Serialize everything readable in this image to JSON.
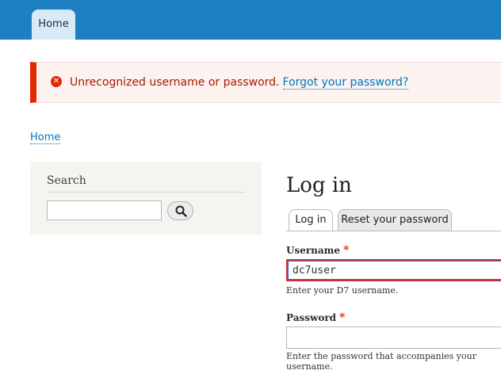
{
  "topbar": {
    "home_tab": "Home"
  },
  "message": {
    "text": "Unrecognized username or password.",
    "link": "Forgot your password?",
    "icon": "error-icon"
  },
  "breadcrumb": {
    "home": "Home"
  },
  "search": {
    "title": "Search",
    "value": "",
    "button_icon": "search-icon"
  },
  "login": {
    "title": "Log in",
    "tabs": [
      {
        "label": "Log in",
        "active": true
      },
      {
        "label": "Reset your password",
        "active": false
      }
    ],
    "username": {
      "label": "Username",
      "required": "*",
      "value": "dc7user",
      "help": "Enter your D7 username."
    },
    "password": {
      "label": "Password",
      "required": "*",
      "value": "",
      "help": "Enter the password that accompanies your username."
    }
  },
  "colors": {
    "topbar": "#1e7fc2",
    "error_accent": "#e32700",
    "link": "#0074bd"
  }
}
